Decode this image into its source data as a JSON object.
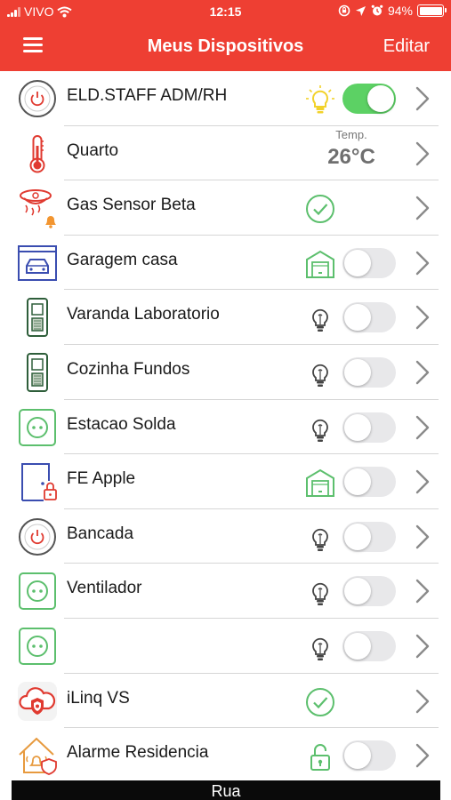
{
  "status_bar": {
    "carrier": "VIVO",
    "time": "12:15",
    "battery": "94%"
  },
  "header": {
    "title": "Meus Dispositivos",
    "edit_label": "Editar",
    "menu_icon": "hamburger-menu-icon"
  },
  "devices": [
    {
      "name": "ELD.STAFF ADM/RH",
      "icon": "power-button-icon",
      "status_icon": "bulb-on-icon",
      "toggle": true
    },
    {
      "name": "Quarto",
      "icon": "thermometer-icon",
      "temp_label": "Temp.",
      "temp_value": "26°C"
    },
    {
      "name": "Gas Sensor Beta",
      "icon": "gas-sensor-icon",
      "status_icon": "check-circle-icon"
    },
    {
      "name": "Garagem casa",
      "icon": "garage-car-icon",
      "status_icon": "garage-door-icon",
      "toggle": false
    },
    {
      "name": "Varanda Laboratorio",
      "icon": "wall-switch-icon",
      "status_icon": "bulb-off-icon",
      "toggle": false
    },
    {
      "name": "Cozinha Fundos",
      "icon": "wall-switch-icon",
      "status_icon": "bulb-off-icon",
      "toggle": false
    },
    {
      "name": "Estacao Solda",
      "icon": "outlet-icon",
      "status_icon": "bulb-off-icon",
      "toggle": false
    },
    {
      "name": "FE Apple",
      "icon": "door-lock-icon",
      "status_icon": "garage-door-icon",
      "toggle": false
    },
    {
      "name": "Bancada",
      "icon": "power-button-icon",
      "status_icon": "bulb-off-icon",
      "toggle": false
    },
    {
      "name": "Ventilador",
      "icon": "outlet-icon",
      "status_icon": "bulb-off-icon",
      "toggle": false
    },
    {
      "name": "",
      "icon": "outlet-icon",
      "status_icon": "bulb-off-icon",
      "toggle": false
    },
    {
      "name": "iLinq VS",
      "icon": "cloud-shield-icon",
      "status_icon": "check-circle-icon"
    },
    {
      "name": "Alarme Residencia",
      "icon": "house-alarm-icon",
      "status_icon": "unlock-icon",
      "toggle": false
    }
  ],
  "footer": {
    "label": "Rua"
  },
  "colors": {
    "header_bg": "#ee3f33",
    "toggle_on": "#5cd164",
    "icon_green": "#5cbf6d",
    "icon_red": "#e03a30",
    "bulb_on": "#f2d22a"
  }
}
